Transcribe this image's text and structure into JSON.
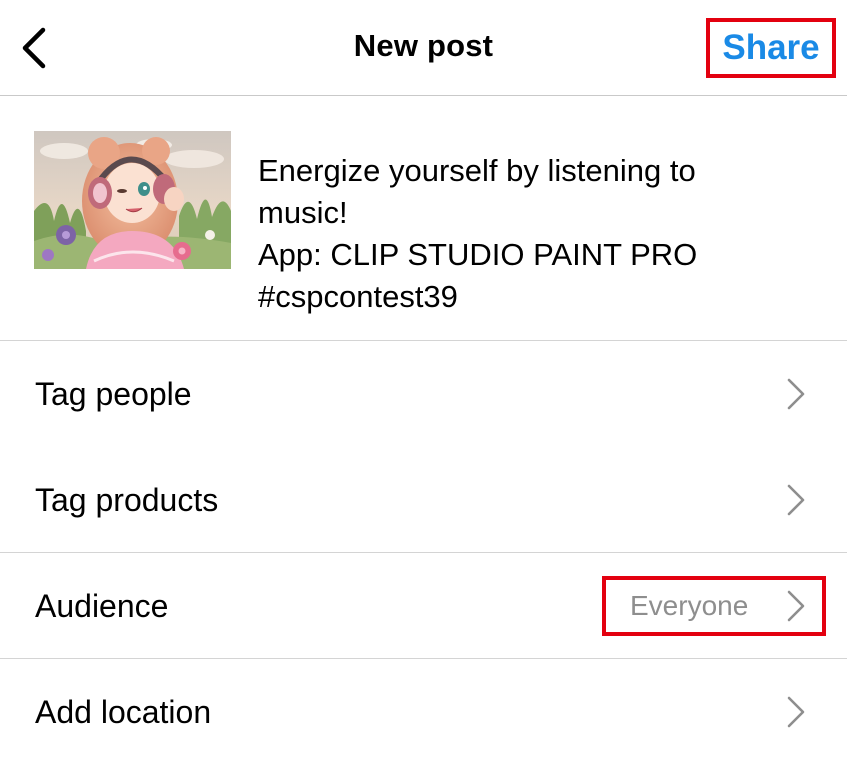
{
  "header": {
    "title": "New post",
    "share_label": "Share",
    "back_icon": "chevron-left-icon"
  },
  "post": {
    "caption": "Energize yourself by listening to\nmusic!\nApp: CLIP STUDIO PAINT PRO\n#cspcontest39"
  },
  "rows": [
    {
      "label": "Tag people",
      "icon": "chevron-right-icon"
    },
    {
      "label": "Tag products",
      "icon": "chevron-right-icon"
    },
    {
      "label": "Audience",
      "value": "Everyone",
      "icon": "chevron-right-icon"
    },
    {
      "label": "Add location",
      "icon": "chevron-right-icon"
    }
  ],
  "colors": {
    "accent": "#1a8ae6",
    "highlight_border": "#e3000f",
    "secondary_text": "#8e8e8e",
    "divider": "#d4d4d4"
  }
}
